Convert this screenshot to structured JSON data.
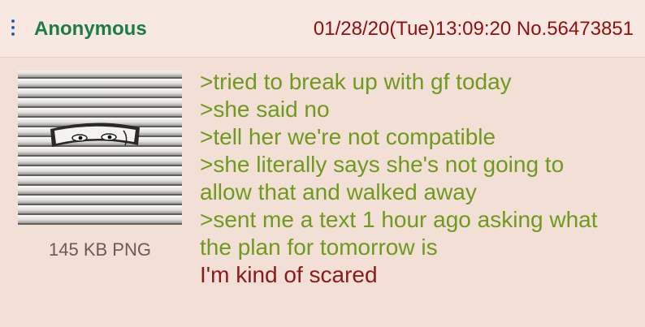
{
  "post": {
    "name": "Anonymous",
    "datetime": "01/28/20(Tue)13:09:20",
    "number": "No.56473851",
    "file": {
      "info": "145 KB PNG"
    },
    "lines": [
      {
        "text": ">tried to break up with gf today",
        "style": "greentext"
      },
      {
        "text": ">she said no",
        "style": "greentext"
      },
      {
        "text": ">tell her we're not compatible",
        "style": "greentext"
      },
      {
        "text": ">she literally says she's not going to",
        "style": "greentext"
      },
      {
        "text": "allow that and walked away",
        "style": "greentext"
      },
      {
        "text": ">sent me a text 1 hour ago asking what",
        "style": "greentext"
      },
      {
        "text": "the plan for tomorrow is",
        "style": "greentext"
      },
      {
        "text": "I'm kind of scared",
        "style": "plain"
      }
    ]
  },
  "colors": {
    "background": "#f2dfd6",
    "header_background": "#f7e9e1",
    "name": "#1d7b45",
    "datetime": "#8f1010",
    "greentext": "#6f9a1e",
    "plain_text": "#8a1a1a",
    "menu_dots": "#2b61b0"
  },
  "icons": {
    "menu": "vertical-dots-icon"
  }
}
